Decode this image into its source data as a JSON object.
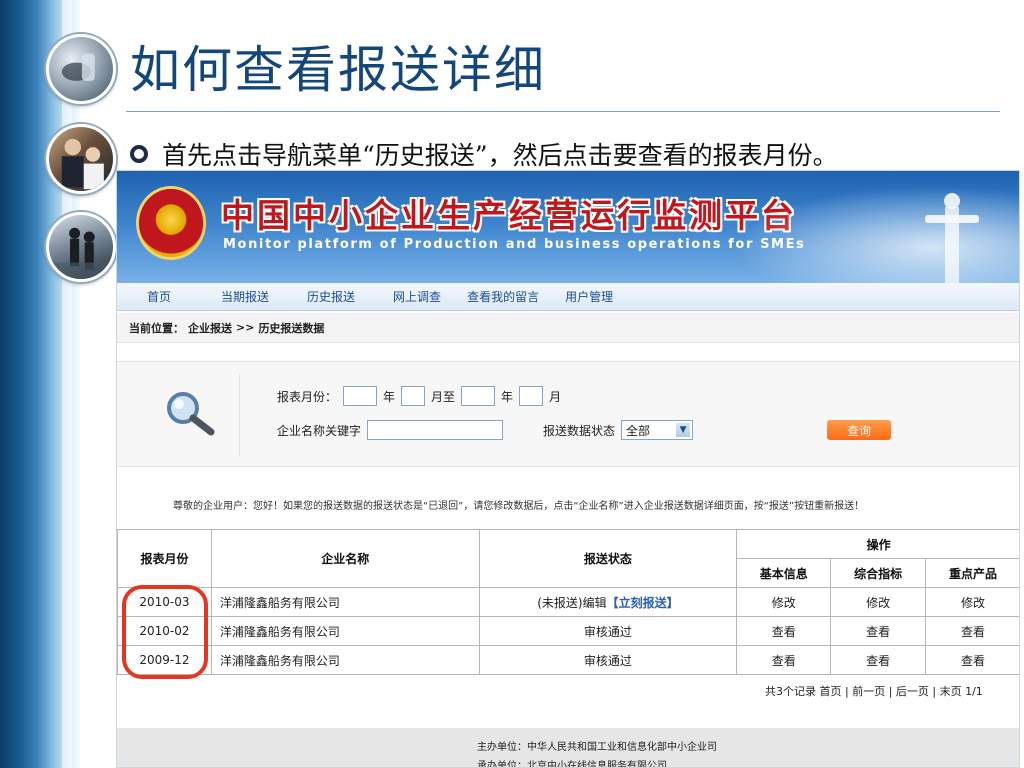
{
  "slide": {
    "title": "如何查看报送详细",
    "bullet": "首先点击导航菜单“历史报送”，然后点击要查看的报表月份。"
  },
  "banner": {
    "title_cn": "中国中小企业生产经营运行监测平台",
    "title_en": "Monitor platform of Production and business operations for SMEs"
  },
  "nav": {
    "items": [
      {
        "label": "首页"
      },
      {
        "label": "当期报送"
      },
      {
        "label": "历史报送"
      },
      {
        "label": "网上调查"
      },
      {
        "label": "查看我的留言"
      },
      {
        "label": "用户管理"
      }
    ]
  },
  "breadcrumb": {
    "prefix": "当前位置：",
    "path1": "企业报送",
    "sep": ">>",
    "path2": "历史报送数据"
  },
  "search": {
    "month_label": "报表月份：",
    "year1": "年",
    "month_to": "月至",
    "year2": "年",
    "month_end": "月",
    "keyword_label": "企业名称关键字",
    "status_label": "报送数据状态",
    "status_value": "全部",
    "query_label": "查询"
  },
  "notice": "尊敬的企业用户：您好！如果您的报送数据的报送状态是“已退回”，请您修改数据后，点击“企业名称”进入企业报送数据详细页面，按“报送”按钮重新报送！",
  "table": {
    "headers": {
      "month": "报表月份",
      "company": "企业名称",
      "status": "报送状态",
      "ops": "操作",
      "basic": "基本信息",
      "indicator": "综合指标",
      "product": "重点产品"
    },
    "rows": [
      {
        "month": "2010-03",
        "company": "洋浦隆鑫船务有限公司",
        "status_pre": "(未报送)编辑",
        "status_link": "【立刻报送】",
        "basic": "修改",
        "indicator": "修改",
        "product": "修改"
      },
      {
        "month": "2010-02",
        "company": "洋浦隆鑫船务有限公司",
        "status_pre": "审核通过",
        "status_link": "",
        "basic": "查看",
        "indicator": "查看",
        "product": "查看"
      },
      {
        "month": "2009-12",
        "company": "洋浦隆鑫船务有限公司",
        "status_pre": "审核通过",
        "status_link": "",
        "basic": "查看",
        "indicator": "查看",
        "product": "查看"
      }
    ]
  },
  "pager": "共3个记录 首页 | 前一页 | 后一页 | 末页 1/1",
  "footer": {
    "host": "主办单位：中华人民共和国工业和信息化部中小企业司",
    "organizer": "承办单位：北京中小在线信息服务有限公司"
  },
  "colors": {
    "title": "#13467b",
    "banner_text": "#c2161c",
    "link": "#2a5fb6",
    "annotation": "#e8351f",
    "query_button": "#ff6a13"
  }
}
